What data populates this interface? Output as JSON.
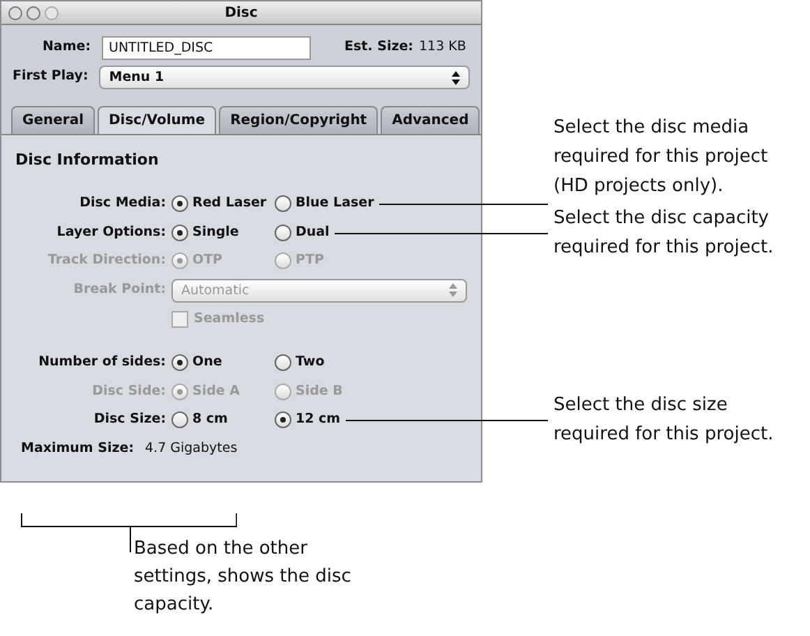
{
  "window": {
    "title": "Disc"
  },
  "name": {
    "label": "Name:",
    "value": "UNTITLED_DISC"
  },
  "est_size": {
    "label": "Est. Size:",
    "value": "113 KB"
  },
  "first_play": {
    "label": "First Play:",
    "value": "Menu 1"
  },
  "tabs": [
    {
      "label": "General",
      "selected": false
    },
    {
      "label": "Disc/Volume",
      "selected": true
    },
    {
      "label": "Region/Copyright",
      "selected": false
    },
    {
      "label": "Advanced",
      "selected": false
    }
  ],
  "section_title": "Disc Information",
  "rows": [
    {
      "kind": "radio",
      "label": "Disc Media:",
      "disabled": false,
      "options": [
        {
          "label": "Red Laser",
          "selected": true
        },
        {
          "label": "Blue Laser",
          "selected": false
        }
      ],
      "callout": "Select the disc media required for this project (HD projects only)."
    },
    {
      "kind": "radio",
      "label": "Layer Options:",
      "disabled": false,
      "options": [
        {
          "label": "Single",
          "selected": true
        },
        {
          "label": "Dual",
          "selected": false
        }
      ],
      "callout": "Select the disc capacity required for this project."
    },
    {
      "kind": "radio",
      "label": "Track Direction:",
      "disabled": true,
      "options": [
        {
          "label": "OTP",
          "selected": true
        },
        {
          "label": "PTP",
          "selected": false
        }
      ]
    },
    {
      "kind": "popup",
      "label": "Break Point:",
      "disabled": true,
      "value": "Automatic"
    },
    {
      "kind": "checkbox",
      "label": "Seamless",
      "disabled": true,
      "checked": false
    },
    {
      "kind": "radio",
      "label": "Number of sides:",
      "disabled": false,
      "options": [
        {
          "label": "One",
          "selected": true
        },
        {
          "label": "Two",
          "selected": false
        }
      ]
    },
    {
      "kind": "radio",
      "label": "Disc Side:",
      "disabled": true,
      "options": [
        {
          "label": "Side A",
          "selected": true
        },
        {
          "label": "Side B",
          "selected": false
        }
      ]
    },
    {
      "kind": "radio",
      "label": "Disc Size:",
      "disabled": false,
      "options": [
        {
          "label": "8 cm",
          "selected": false
        },
        {
          "label": "12 cm",
          "selected": true
        }
      ],
      "callout": "Select the disc size required for this project."
    },
    {
      "kind": "info",
      "label": "Maximum Size:",
      "value": "4.7 Gigabytes",
      "callout": "Based on the other settings, shows the disc capacity."
    }
  ]
}
